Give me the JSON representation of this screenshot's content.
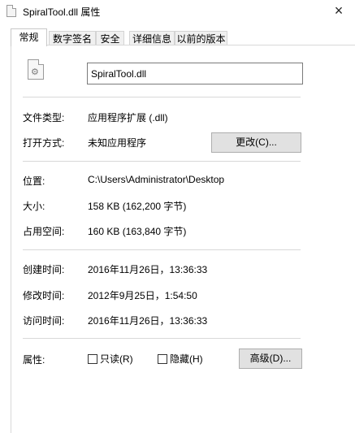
{
  "window": {
    "title": "SpiralTool.dll 属性",
    "close_glyph": "×"
  },
  "tabs": [
    {
      "label": "常规",
      "active": true
    },
    {
      "label": "数字签名",
      "active": false
    },
    {
      "label": "安全",
      "active": false
    },
    {
      "label": "详细信息",
      "active": false
    },
    {
      "label": "以前的版本",
      "active": false
    }
  ],
  "general": {
    "file_icon": "dll-gear-file-icon",
    "filename": "SpiralTool.dll",
    "type_label": "文件类型:",
    "type_value": "应用程序扩展 (.dll)",
    "opens_with_label": "打开方式:",
    "opens_with_value": "未知应用程序",
    "change_button": "更改(C)...",
    "location_label": "位置:",
    "location_value": "C:\\Users\\Administrator\\Desktop",
    "size_label": "大小:",
    "size_value": "158 KB (162,200 字节)",
    "size_on_disk_label": "占用空间:",
    "size_on_disk_value": "160 KB (163,840 字节)",
    "created_label": "创建时间:",
    "created_value": "2016年11月26日，13:36:33",
    "modified_label": "修改时间:",
    "modified_value": "2012年9月25日，1:54:50",
    "accessed_label": "访问时间:",
    "accessed_value": "2016年11月26日，13:36:33",
    "attributes_label": "属性:",
    "readonly_label": "只读(R)",
    "readonly_checked": false,
    "hidden_label": "隐藏(H)",
    "hidden_checked": false,
    "advanced_button": "高级(D)..."
  }
}
